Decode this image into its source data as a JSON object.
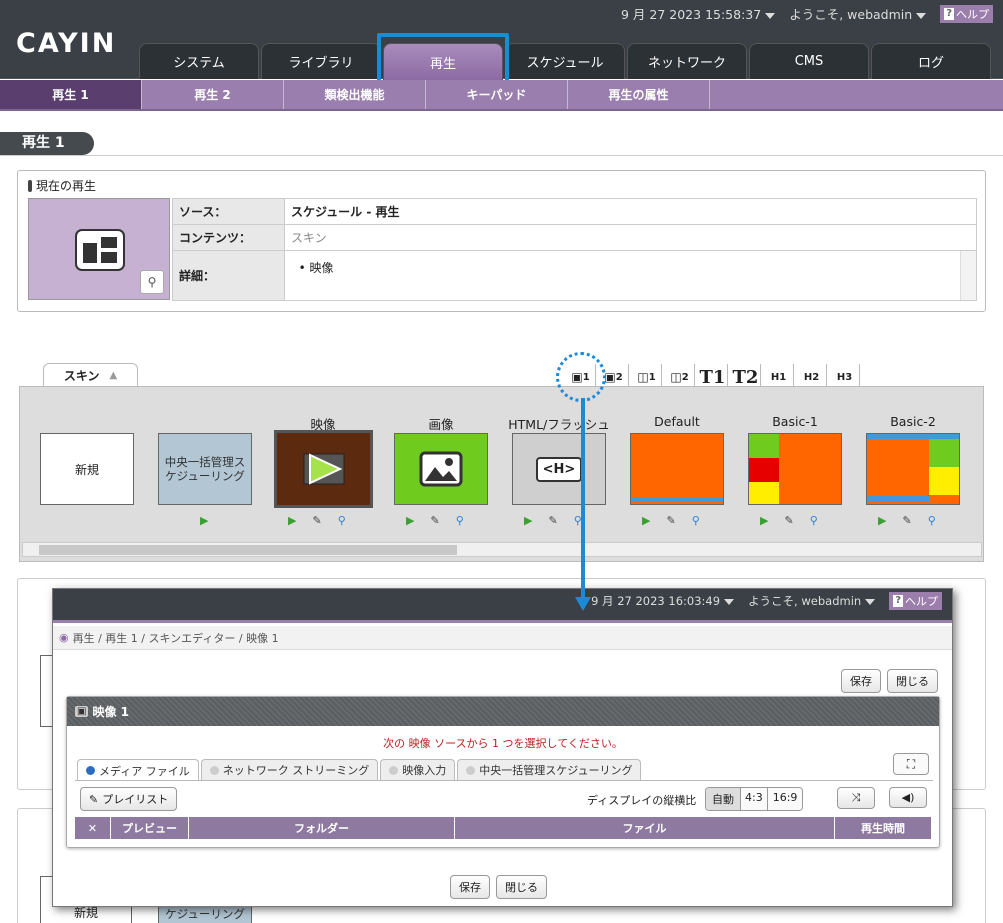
{
  "header": {
    "datetime": "9 月 27 2023 15:58:37",
    "welcome": "ようこそ, webadmin",
    "help": "ヘルプ",
    "logo": "CAYIN"
  },
  "tabs": [
    "システム",
    "ライブラリ",
    "再生",
    "スケジュール",
    "ネットワーク",
    "CMS",
    "ログ"
  ],
  "subnav": [
    "再生 1",
    "再生 2",
    "類検出機能",
    "キーパッド",
    "再生の属性"
  ],
  "page_title": "再生 1",
  "current": {
    "section": "現在の再生",
    "rows": [
      {
        "k": "ソース：",
        "v": "スケジュール - 再生"
      },
      {
        "k": "コンテンツ：",
        "v": "スキン"
      },
      {
        "k": "詳細：",
        "v": "映像"
      }
    ]
  },
  "skin": {
    "tab": "スキン",
    "items": [
      {
        "label": "",
        "text": "新規",
        "bg": "#ffffff"
      },
      {
        "label": "",
        "text": "中央一括管理スケジューリング",
        "bg": "#b2c6d4"
      },
      {
        "label": "映像",
        "text": "",
        "bg": "#5c2a0e"
      },
      {
        "label": "画像",
        "text": "",
        "bg": "#6fcc1e"
      },
      {
        "label": "HTML/フラッシュ",
        "text": "<H>",
        "bg": "#cfcfcf"
      },
      {
        "label": "Default",
        "text": "",
        "bg": "#ff6600"
      },
      {
        "label": "Basic-1",
        "text": "",
        "bg": "#ff6600"
      },
      {
        "label": "Basic-2",
        "text": "",
        "bg": "#ff6600"
      }
    ],
    "toolbar": [
      "1",
      "2",
      "1",
      "2",
      "T1",
      "T2",
      "H1",
      "H2",
      "H3"
    ]
  },
  "popup": {
    "datetime": "9 月 27 2023 16:03:49",
    "welcome": "ようこそ, webadmin",
    "help": "ヘルプ",
    "breadcrumb": "再生 / 再生 1 / スキンエディター / 映像 1",
    "save": "保存",
    "close": "閉じる",
    "title": "映像 1",
    "instruction": "次の 映像 ソースから 1 つを選択してください。",
    "srctabs": [
      "メディア ファイル",
      "ネットワーク ストリーミング",
      "映像入力",
      "中央一括管理スケジューリング"
    ],
    "playlist": "プレイリスト",
    "aspect_label": "ディスプレイの縦横比",
    "aspect_opts": [
      "自動",
      "4:3",
      "16:9"
    ],
    "columns": [
      "プレビュー",
      "フォルダー",
      "ファイル",
      "再生時間"
    ]
  },
  "bg_items": {
    "new": "新規",
    "central": "中央一括管理スケジューリング"
  }
}
